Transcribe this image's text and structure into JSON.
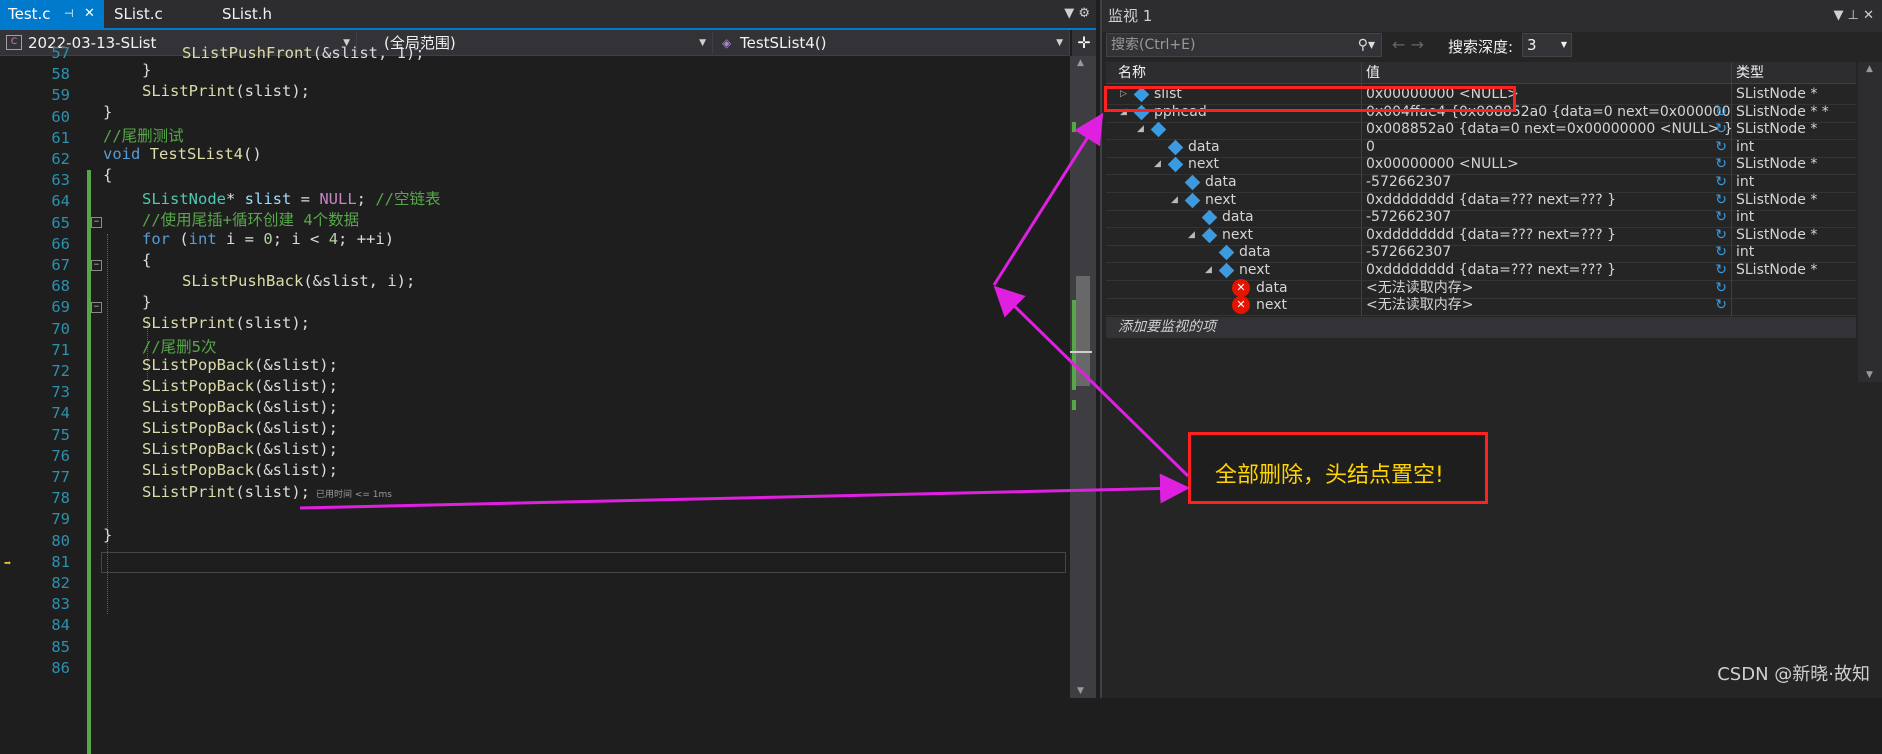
{
  "tabs": [
    {
      "label": "Test.c",
      "pin": "⊣",
      "close": "✕"
    },
    {
      "label": "SList.c"
    },
    {
      "label": "SList.h"
    }
  ],
  "tabbar_controls": "▼ ⚙",
  "navbar": {
    "project": "2022-03-13-SList",
    "scope": "(全局范围)",
    "function": "TestSList4()"
  },
  "code": {
    "line_numbers": [
      "57",
      "58",
      "59",
      "60",
      "61",
      "62",
      "63",
      "64",
      "65",
      "66",
      "67",
      "68",
      "69",
      "70",
      "71",
      "72",
      "73",
      "74",
      "75",
      "76",
      "77",
      "78",
      "79",
      "80",
      "81",
      "82",
      "83",
      "84",
      "85",
      "86"
    ],
    "l57_a": "SListPushFront",
    "l57_b": "(&slist, 1);",
    "l58": "}",
    "l59_a": "SListPrint",
    "l59_b": "(slist);",
    "l60": "}",
    "l61": "//尾删测试",
    "l62_kw": "void",
    "l62_fn": "TestSList4",
    "l62_b": "()",
    "l63": "{",
    "l64_ty": "SListNode",
    "l64_b": "* ",
    "l64_v": "slist",
    "l64_c": " = ",
    "l64_null": "NULL",
    "l64_d": "; ",
    "l64_cm": "//空链表",
    "l65": "//使用尾插+循环创建 4个数据",
    "l66_kw": "for",
    "l66_a": " (",
    "l66_int": "int",
    "l66_b": " i = ",
    "l66_n0": "0",
    "l66_c": "; i < ",
    "l66_n4": "4",
    "l66_d": "; ++i)",
    "l67": "{",
    "l68_a": "SListPushBack",
    "l68_b": "(&slist, i);",
    "l69": "}",
    "l70_a": "SListPrint",
    "l70_b": "(slist);",
    "l71": "//尾删5次",
    "pop_fn": "SListPopBack",
    "pop_args": "(&slist);",
    "l78_a": "SListPrint",
    "l78_b": "(slist);",
    "l78_elapsed": "已用时间 <= 1ms",
    "l80": "}"
  },
  "watch": {
    "title": "监视 1",
    "title_controls": "▼ ⊥ ✕",
    "search_placeholder": "搜索(Ctrl+E)",
    "search_icon": "⚲▾",
    "nav_arrows": "← →",
    "depth_label": "搜索深度:",
    "depth_value": "3",
    "headers": {
      "name": "名称",
      "value": "值",
      "type": "类型"
    },
    "rows": [
      {
        "name": "slist",
        "value": "0x00000000 <NULL>",
        "type": "SListNode *"
      },
      {
        "name": "pphead",
        "value": "0x004ffae4 {0x008852a0 {data=0 next=0x0000000...",
        "type": "SListNode * *"
      },
      {
        "name": "",
        "value": "0x008852a0 {data=0 next=0x00000000 <NULL> }",
        "type": "SListNode *"
      },
      {
        "name": "data",
        "value": "0",
        "type": "int"
      },
      {
        "name": "next",
        "value": "0x00000000 <NULL>",
        "type": "SListNode *"
      },
      {
        "name": "data",
        "value": "-572662307",
        "type": "int"
      },
      {
        "name": "next",
        "value": "0xdddddddd {data=??? next=??? }",
        "type": "SListNode *"
      },
      {
        "name": "data",
        "value": "-572662307",
        "type": "int"
      },
      {
        "name": "next",
        "value": "0xdddddddd {data=??? next=??? }",
        "type": "SListNode *"
      },
      {
        "name": "data",
        "value": "-572662307",
        "type": "int"
      },
      {
        "name": "next",
        "value": "0xdddddddd {data=??? next=??? }",
        "type": "SListNode *"
      },
      {
        "name": "data",
        "value": "<无法读取内存>",
        "type": ""
      },
      {
        "name": "next",
        "value": "<无法读取内存>",
        "type": ""
      }
    ],
    "add_watch": "添加要监视的项"
  },
  "annotation": {
    "callout_text": "全部删除，头结点置空!",
    "highlight_color": "#ff2020",
    "arrow_color": "#e020e0",
    "text_color": "#ffd400"
  },
  "watermark": "CSDN @新晓·故知"
}
